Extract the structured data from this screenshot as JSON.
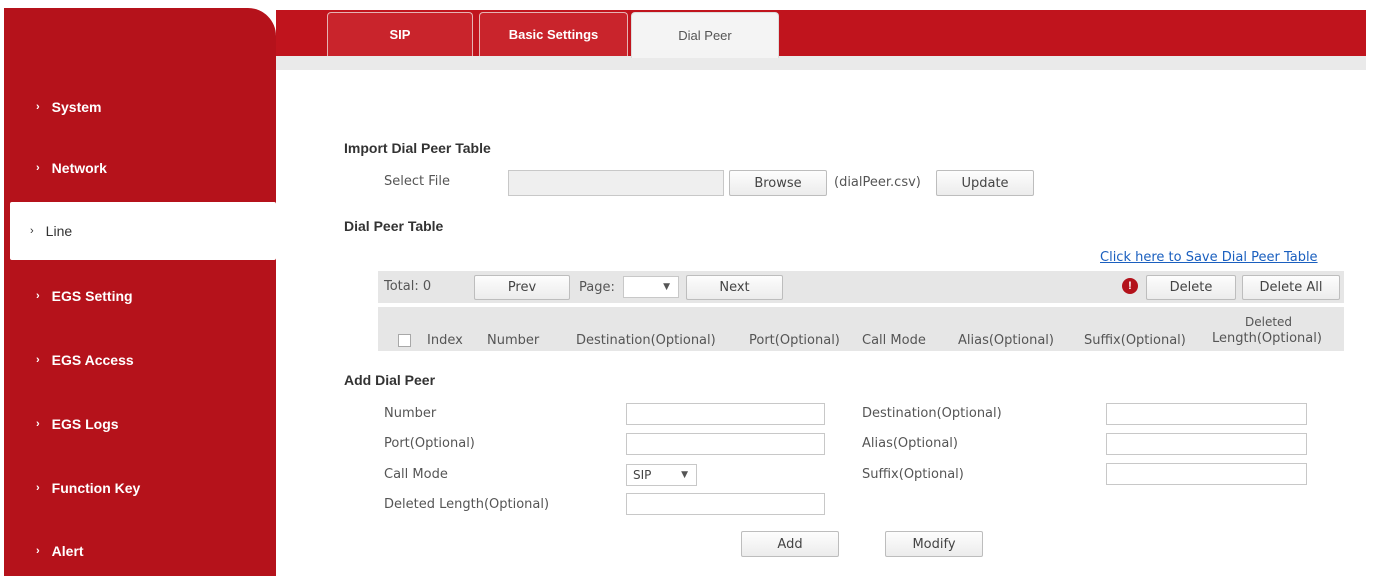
{
  "sidebar": {
    "items": [
      {
        "label": "System"
      },
      {
        "label": "Network"
      },
      {
        "label": "Line"
      },
      {
        "label": "EGS Setting"
      },
      {
        "label": "EGS Access"
      },
      {
        "label": "EGS Logs"
      },
      {
        "label": "Function Key"
      },
      {
        "label": "Alert"
      }
    ],
    "active": "Line",
    "chevron": "›"
  },
  "tabs": [
    {
      "label": "SIP"
    },
    {
      "label": "Basic Settings"
    },
    {
      "label": "Dial Peer"
    }
  ],
  "import": {
    "title": "Import Dial Peer Table",
    "select_file_label": "Select File",
    "browse_label": "Browse",
    "filename_hint": "(dialPeer.csv)",
    "update_label": "Update"
  },
  "table": {
    "title": "Dial Peer Table",
    "save_link": "Click here to Save Dial Peer Table",
    "total": "Total: 0",
    "prev_label": "Prev",
    "page_label": "Page:",
    "next_label": "Next",
    "warn_glyph": "!",
    "delete_label": "Delete",
    "delete_all_label": "Delete All",
    "columns": [
      "Index",
      "Number",
      "Destination(Optional)",
      "Port(Optional)",
      "Call Mode",
      "Alias(Optional)",
      "Suffix(Optional)"
    ],
    "deleted_col_line1": "Deleted",
    "deleted_col_line2": "Length(Optional)"
  },
  "add": {
    "title": "Add Dial Peer",
    "number_label": "Number",
    "port_label": "Port(Optional)",
    "call_mode_label": "Call Mode",
    "call_mode_value": "SIP",
    "deleted_length_label": "Deleted Length(Optional)",
    "destination_label": "Destination(Optional)",
    "alias_label": "Alias(Optional)",
    "suffix_label": "Suffix(Optional)",
    "add_label": "Add",
    "modify_label": "Modify"
  },
  "colors": {
    "brand_red": "#b5121b",
    "link_blue": "#1a5fbf"
  }
}
